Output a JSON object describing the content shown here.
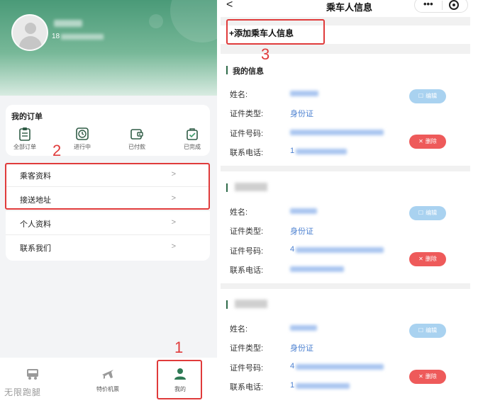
{
  "left_screen": {
    "user": {
      "phone_prefix": "18"
    },
    "orders": {
      "title": "我的订单",
      "items": [
        {
          "label": "全部订单",
          "icon": "clipboard-icon"
        },
        {
          "label": "进行中",
          "icon": "clock-icon"
        },
        {
          "label": "已付款",
          "icon": "wallet-icon"
        },
        {
          "label": "已完成",
          "icon": "check-bag-icon"
        }
      ]
    },
    "menu": [
      {
        "label": "乘客资料",
        "arrow": ">"
      },
      {
        "label": "接送地址",
        "arrow": ">"
      },
      {
        "label": "个人资料",
        "arrow": ">"
      },
      {
        "label": "联系我们",
        "arrow": ">"
      }
    ],
    "tabbar": [
      {
        "label": "",
        "icon": "bus-icon"
      },
      {
        "label": "特价机票",
        "icon": "airplane-icon"
      },
      {
        "label": "我的",
        "icon": "person-icon",
        "active": true
      }
    ],
    "watermark": "无限跑腿",
    "accent_green": "#2f7a55"
  },
  "annotations": {
    "step1": "1",
    "step2": "2",
    "step3": "3",
    "color": "#e03b3b"
  },
  "right_screen": {
    "nav": {
      "back": "<",
      "title": "乘车人信息",
      "more": "•••"
    },
    "add_passenger": "+添加乘车人信息",
    "passengers": [
      {
        "section_title": "我的信息",
        "fields": [
          {
            "label": "姓名:",
            "value": ""
          },
          {
            "label": "证件类型:",
            "value": "身份证"
          },
          {
            "label": "证件号码:",
            "value": ""
          },
          {
            "label": "联系电话:",
            "value": "1"
          }
        ],
        "edit_label": "编辑",
        "delete_label": "删除"
      },
      {
        "section_title": "",
        "fields": [
          {
            "label": "姓名:",
            "value": ""
          },
          {
            "label": "证件类型:",
            "value": "身份证"
          },
          {
            "label": "证件号码:",
            "value": "4"
          },
          {
            "label": "联系电话:",
            "value": ""
          }
        ],
        "edit_label": "编辑",
        "delete_label": "删除"
      },
      {
        "section_title": "",
        "fields": [
          {
            "label": "姓名:",
            "value": ""
          },
          {
            "label": "证件类型:",
            "value": "身份证"
          },
          {
            "label": "证件号码:",
            "value": "4"
          },
          {
            "label": "联系电话:",
            "value": "1"
          }
        ],
        "edit_label": "编辑",
        "delete_label": "删除"
      }
    ],
    "colors": {
      "value_blue": "#4a7fd0",
      "edit_blue": "#a9d2f0",
      "delete_red": "#ee5a5a"
    }
  }
}
